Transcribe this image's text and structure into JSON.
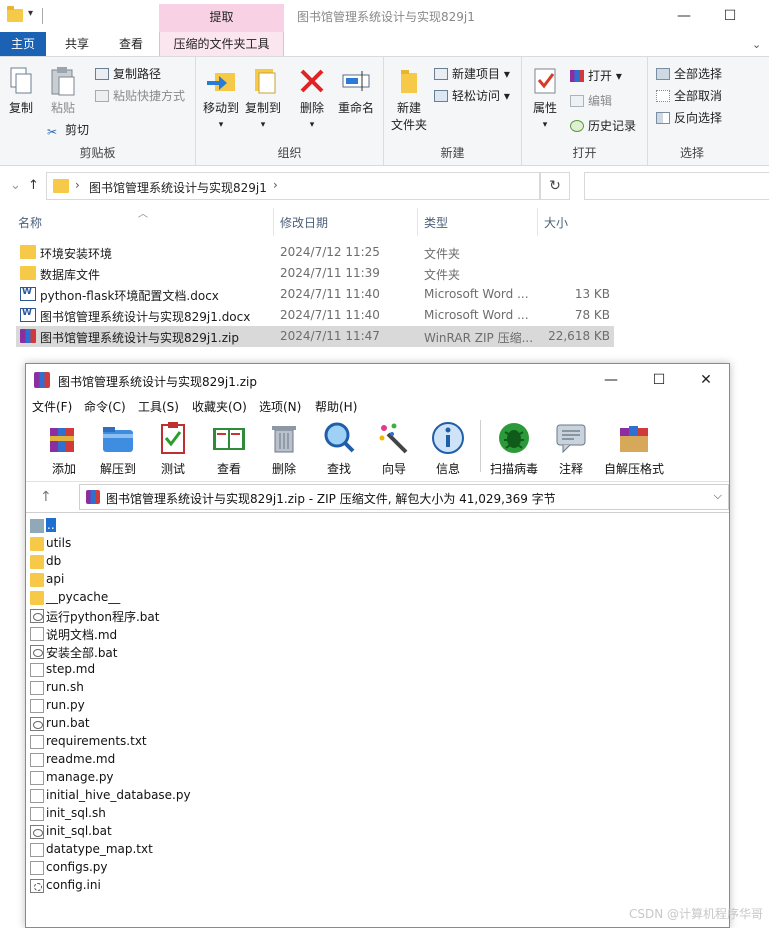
{
  "explorer": {
    "window_title": "图书馆管理系统设计与实现829j1",
    "context_tab_header": "提取",
    "window_controls": {
      "minimize": "—",
      "maximize": "☐"
    },
    "tabs": [
      {
        "label": "主页",
        "active": true
      },
      {
        "label": "共享"
      },
      {
        "label": "查看"
      },
      {
        "label": "压缩的文件夹工具",
        "context": true
      }
    ],
    "ribbon": {
      "clipboard": {
        "label": "剪贴板",
        "copy": "复制",
        "paste": "粘贴",
        "copy_path": "复制路径",
        "paste_shortcut": "粘贴快捷方式",
        "cut": "剪切"
      },
      "organize": {
        "label": "组织",
        "move_to": "移动到",
        "copy_to": "复制到",
        "delete": "删除",
        "rename": "重命名"
      },
      "new": {
        "label": "新建",
        "new_folder": "新建\n文件夹",
        "new_folder_line1": "新建",
        "new_folder_line2": "文件夹",
        "new_item": "新建项目 ▾",
        "easy_access": "轻松访问 ▾"
      },
      "open": {
        "label": "打开",
        "properties": "属性",
        "open": "打开 ▾",
        "edit": "编辑",
        "history": "历史记录"
      },
      "select": {
        "label": "选择",
        "select_all": "全部选择",
        "select_none": "全部取消",
        "invert": "反向选择"
      }
    },
    "address": {
      "breadcrumb_sep": "›",
      "path": "图书馆管理系统设计与实现829j1",
      "trail_sep": "›",
      "refresh": "↻"
    },
    "columns": {
      "name": "名称",
      "date": "修改日期",
      "type": "类型",
      "size": "大小"
    },
    "files": [
      {
        "name": "环境安装环境",
        "date": "2024/7/12 11:25",
        "type": "文件夹",
        "size": "",
        "icon": "folder-icon"
      },
      {
        "name": "数据库文件",
        "date": "2024/7/11 11:39",
        "type": "文件夹",
        "size": "",
        "icon": "folder-icon"
      },
      {
        "name": "python-flask环境配置文档.docx",
        "date": "2024/7/11 11:40",
        "type": "Microsoft Word ...",
        "size": "13 KB",
        "icon": "word-icon"
      },
      {
        "name": "图书馆管理系统设计与实现829j1.docx",
        "date": "2024/7/11 11:40",
        "type": "Microsoft Word ...",
        "size": "78 KB",
        "icon": "word-icon"
      },
      {
        "name": "图书馆管理系统设计与实现829j1.zip",
        "date": "2024/7/11 11:47",
        "type": "WinRAR ZIP 压缩...",
        "size": "22,618 KB",
        "icon": "winrar-icon",
        "selected": true
      }
    ]
  },
  "winrar": {
    "title": "图书馆管理系统设计与实现829j1.zip",
    "controls": {
      "minimize": "—",
      "maximize": "☐",
      "close": "✕"
    },
    "menu": [
      "文件(F)",
      "命令(C)",
      "工具(S)",
      "收藏夹(O)",
      "选项(N)",
      "帮助(H)"
    ],
    "toolbar": [
      "添加",
      "解压到",
      "测试",
      "查看",
      "删除",
      "查找",
      "向导",
      "信息",
      "扫描病毒",
      "注释",
      "自解压格式"
    ],
    "path_up": "↑",
    "path_text": "图书馆管理系统设计与实现829j1.zip - ZIP 压缩文件, 解包大小为 41,029,369 字节",
    "path_caret": "⌵",
    "entries": [
      {
        "name": "..",
        "kind": "up"
      },
      {
        "name": "utils",
        "kind": "folder"
      },
      {
        "name": "db",
        "kind": "folder"
      },
      {
        "name": "api",
        "kind": "folder"
      },
      {
        "name": "__pycache__",
        "kind": "folder"
      },
      {
        "name": "运行python程序.bat",
        "kind": "bat"
      },
      {
        "name": "说明文档.md",
        "kind": "file"
      },
      {
        "name": "安装全部.bat",
        "kind": "bat"
      },
      {
        "name": "step.md",
        "kind": "file"
      },
      {
        "name": "run.sh",
        "kind": "file"
      },
      {
        "name": "run.py",
        "kind": "file"
      },
      {
        "name": "run.bat",
        "kind": "bat"
      },
      {
        "name": "requirements.txt",
        "kind": "file"
      },
      {
        "name": "readme.md",
        "kind": "file"
      },
      {
        "name": "manage.py",
        "kind": "file"
      },
      {
        "name": "initial_hive_database.py",
        "kind": "file"
      },
      {
        "name": "init_sql.sh",
        "kind": "file"
      },
      {
        "name": "init_sql.bat",
        "kind": "bat"
      },
      {
        "name": "datatype_map.txt",
        "kind": "file"
      },
      {
        "name": "configs.py",
        "kind": "file"
      },
      {
        "name": "config.ini",
        "kind": "ini"
      }
    ]
  },
  "watermark": "CSDN @计算机程序华哥",
  "colors": {
    "accent": "#1b62b4",
    "context_tab": "#f8d2e4",
    "selection": "#d9d9d9",
    "winrar_selection": "#1e6fcf"
  }
}
